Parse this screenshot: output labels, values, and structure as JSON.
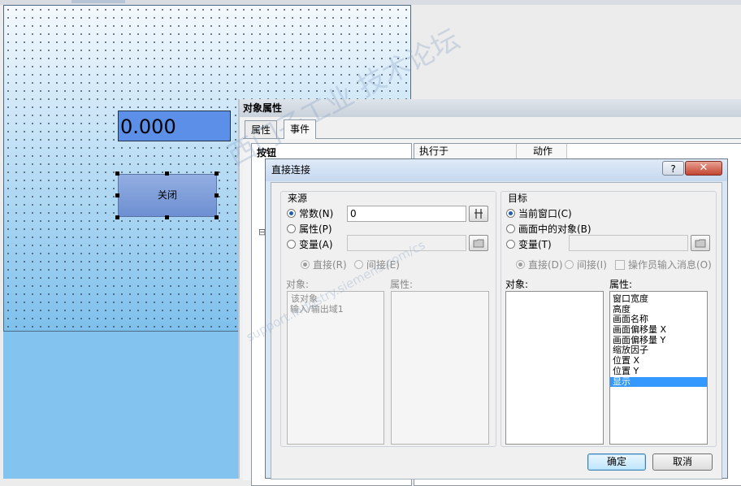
{
  "canvas": {
    "io_field_value": "0.000",
    "close_button_label": "关闭"
  },
  "object_properties": {
    "title": "对象属性",
    "tabs": [
      {
        "label": "属性",
        "active": false
      },
      {
        "label": "事件",
        "active": true
      }
    ],
    "tree_header": "按钮",
    "tree_collapse_glyph": "⊟",
    "grid_headers": [
      "执行于",
      "动作"
    ]
  },
  "dialog": {
    "title": "直接连接",
    "help_label": "?",
    "close_label": "✕",
    "source": {
      "group_title": "来源",
      "radios": [
        {
          "label": "常数(N)",
          "checked": true
        },
        {
          "label": "属性(P)",
          "checked": false
        },
        {
          "label": "变量(A)",
          "checked": false
        }
      ],
      "constant_value": "0",
      "sub_radios": [
        {
          "label": "直接(R)",
          "checked": true
        },
        {
          "label": "间接(E)",
          "checked": false
        }
      ],
      "object_label": "对象:",
      "property_label": "属性:",
      "objects": [
        "该对象",
        "输入/输出域1"
      ]
    },
    "target": {
      "group_title": "目标",
      "radios": [
        {
          "label": "当前窗口(C)",
          "checked": true
        },
        {
          "label": "画面中的对象(B)",
          "checked": false
        },
        {
          "label": "变量(T)",
          "checked": false
        }
      ],
      "sub_radios": [
        {
          "label": "直接(D)",
          "checked": true
        },
        {
          "label": "间接(I)",
          "checked": false
        }
      ],
      "operator_msg_label": "操作员输入消息(O)",
      "object_label": "对象:",
      "property_label": "属性:",
      "properties": [
        "窗口宽度",
        "高度",
        "画面名称",
        "画面偏移量 X",
        "画面偏移量 Y",
        "缩放因子",
        "位置 X",
        "位置 Y",
        "显示"
      ],
      "selected_property": "显示"
    },
    "ok_label": "确定",
    "cancel_label": "取消"
  },
  "watermark": {
    "text": "西门子工业 技术论坛",
    "url": "support.industry.siemens.com/cs"
  },
  "colors": {
    "selection": "#3399ff",
    "io_field_bg": "#5b8fe8"
  },
  "icons": {
    "tag_browse": "tag-browse-icon",
    "folder_browse": "folder-browse-icon",
    "cursor": "red-arrow-cursor-icon"
  }
}
